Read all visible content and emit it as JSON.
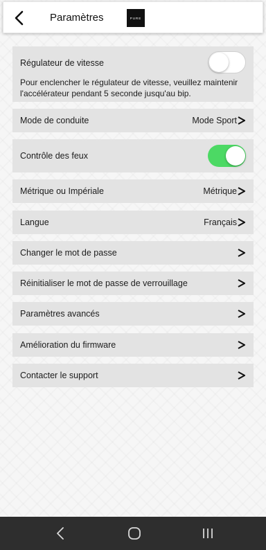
{
  "header": {
    "title": "Paramètres",
    "logo_text": "PURE",
    "back_icon": "chevron-left-icon"
  },
  "settings": {
    "cruise": {
      "label": "Régulateur de vitesse",
      "toggle_on": false,
      "description": "Pour enclencher le régulateur de vitesse, veuillez maintenir l'accélérateur pendant 5 seconde jusqu'au bip."
    },
    "drive_mode": {
      "label": "Mode de conduite",
      "value": "Mode Sport"
    },
    "lights": {
      "label": "Contrôle des feux",
      "toggle_on": true
    },
    "units": {
      "label": "Métrique ou Impériale",
      "value": "Métrique"
    },
    "language": {
      "label": "Langue",
      "value": "Français"
    },
    "change_password": {
      "label": "Changer le mot de passe"
    },
    "reset_lock_password": {
      "label": "Réinitialiser le mot de passe de verrouillage"
    },
    "advanced": {
      "label": "Paramètres avancés"
    },
    "firmware": {
      "label": "Amélioration du firmware"
    },
    "support": {
      "label": "Contacter le support"
    }
  },
  "colors": {
    "row_bg": "#e3e3e3",
    "toggle_on": "#4cd964",
    "navbar_bg": "#2e2e2e"
  },
  "navbar": {
    "icons": [
      "back-icon",
      "home-icon",
      "recent-apps-icon"
    ]
  }
}
